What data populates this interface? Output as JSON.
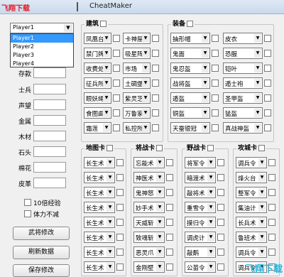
{
  "window": {
    "logo": "飞翔下载",
    "title": "CheatMaker"
  },
  "player_select": {
    "value": "Player1",
    "options": [
      "Player1",
      "Player2",
      "Player3",
      "Player4"
    ]
  },
  "stats": [
    {
      "label": "存款"
    },
    {
      "label": "士兵"
    },
    {
      "label": "声望"
    },
    {
      "label": "金属"
    },
    {
      "label": "木材"
    },
    {
      "label": "石头"
    },
    {
      "label": "棉花"
    },
    {
      "label": "皮革"
    }
  ],
  "options": {
    "exp10": "10倍经验",
    "ward": "体力不减"
  },
  "buttons": {
    "modify_general": "武将修改",
    "refresh": "刷新数据",
    "save": "保存修改"
  },
  "groups": {
    "building": {
      "title": "建筑",
      "items": [
        "凤凰台",
        "卡神屋",
        "禁门牌",
        "吸星阵",
        "收费处",
        "市场",
        "征兵所",
        "土碉堡",
        "眼妖绳",
        "紫灵芝",
        "食图曲",
        "万鲁家",
        "霜莲",
        "私控所"
      ]
    },
    "equipment": {
      "title": "装备",
      "items": [
        "抽形帽",
        "皮衣",
        "鬼面",
        "恐服",
        "鬼忍盔",
        "铠叶",
        "战将盔",
        "遁士袍",
        "遁盔",
        "圣甲盔",
        "铜盔",
        "猛盔",
        "天蚕银冠",
        "真战神盔"
      ]
    },
    "map_card": {
      "title": "地图卡",
      "items": [
        "长生术",
        "长生术",
        "长生术",
        "长生术",
        "长生术",
        "长生术",
        "长生术",
        "长生术"
      ]
    },
    "general_card": {
      "title": "将战卡",
      "items": [
        "忘能术",
        "神医术",
        "鬼神怒",
        "妙手术",
        "天威斩",
        "致魂斩",
        "恶灵爪",
        "金刚壁"
      ]
    },
    "field_card": {
      "title": "野战卡",
      "items": [
        "将军令",
        "暗渡术",
        "敲将术",
        "重雪令",
        "摸归令",
        "调虎计",
        "敲鹬",
        "公苗令"
      ]
    },
    "siege_card": {
      "title": "攻城卡",
      "items": [
        "调兵令",
        "烽火台",
        "整军令",
        "集油计",
        "长兵术",
        "鲁班术",
        "调兵令",
        "调兵令"
      ]
    }
  },
  "watermark": "飞翔下载"
}
